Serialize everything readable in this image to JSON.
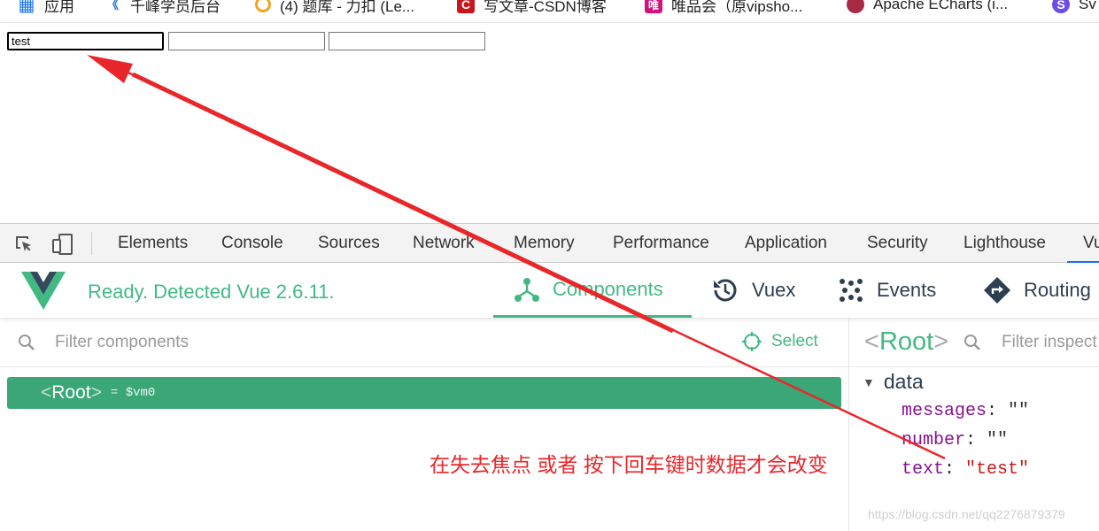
{
  "bookmarks": [
    {
      "label": "应用",
      "icon": "apps-grid-icon"
    },
    {
      "label": "千峰学员后台",
      "icon": "qianfeng-icon"
    },
    {
      "label": "(4) 题库 - 力扣 (Le...",
      "icon": "leetcode-icon"
    },
    {
      "label": "写文章-CSDN博客",
      "icon": "csdn-icon"
    },
    {
      "label": "唯品会（原vipsho...",
      "icon": "vipshop-icon"
    },
    {
      "label": "Apache ECharts (i...",
      "icon": "echarts-icon"
    },
    {
      "label": "Sv",
      "icon": "s-icon"
    }
  ],
  "page_inputs": {
    "input1_value": "test",
    "input2_value": "",
    "input3_value": ""
  },
  "devtools": {
    "tabs": [
      "Elements",
      "Console",
      "Sources",
      "Network",
      "Memory",
      "Performance",
      "Application",
      "Security",
      "Lighthouse",
      "Vu"
    ],
    "active_tab": "Vu"
  },
  "vue": {
    "ready_text": "Ready. Detected Vue 2.6.11.",
    "tabs": [
      "Components",
      "Vuex",
      "Events",
      "Routing"
    ],
    "active_tab": "Components",
    "filter_placeholder": "Filter components",
    "select_label": "Select",
    "tree_root": {
      "open": "<",
      "name": "Root",
      "close": ">",
      "vm": "= $vm0"
    },
    "inspector": {
      "root_open": "<",
      "root_name": "Root",
      "root_close": ">",
      "filter_placeholder": "Filter inspect",
      "section": "data",
      "props": [
        {
          "key": "messages",
          "value": "\"\""
        },
        {
          "key": "number",
          "value": "\"\""
        },
        {
          "key": "text",
          "value": "\"test\""
        }
      ]
    }
  },
  "annotation": {
    "text": "在失去焦点 或者 按下回车键时数据才会改变",
    "color": "#e8272b"
  },
  "watermark": "https://blog.csdn.net/qq2276879379",
  "colors": {
    "vue_green": "#42b983",
    "active_row": "#3ba776",
    "devtools_active": "#1a73e8"
  }
}
